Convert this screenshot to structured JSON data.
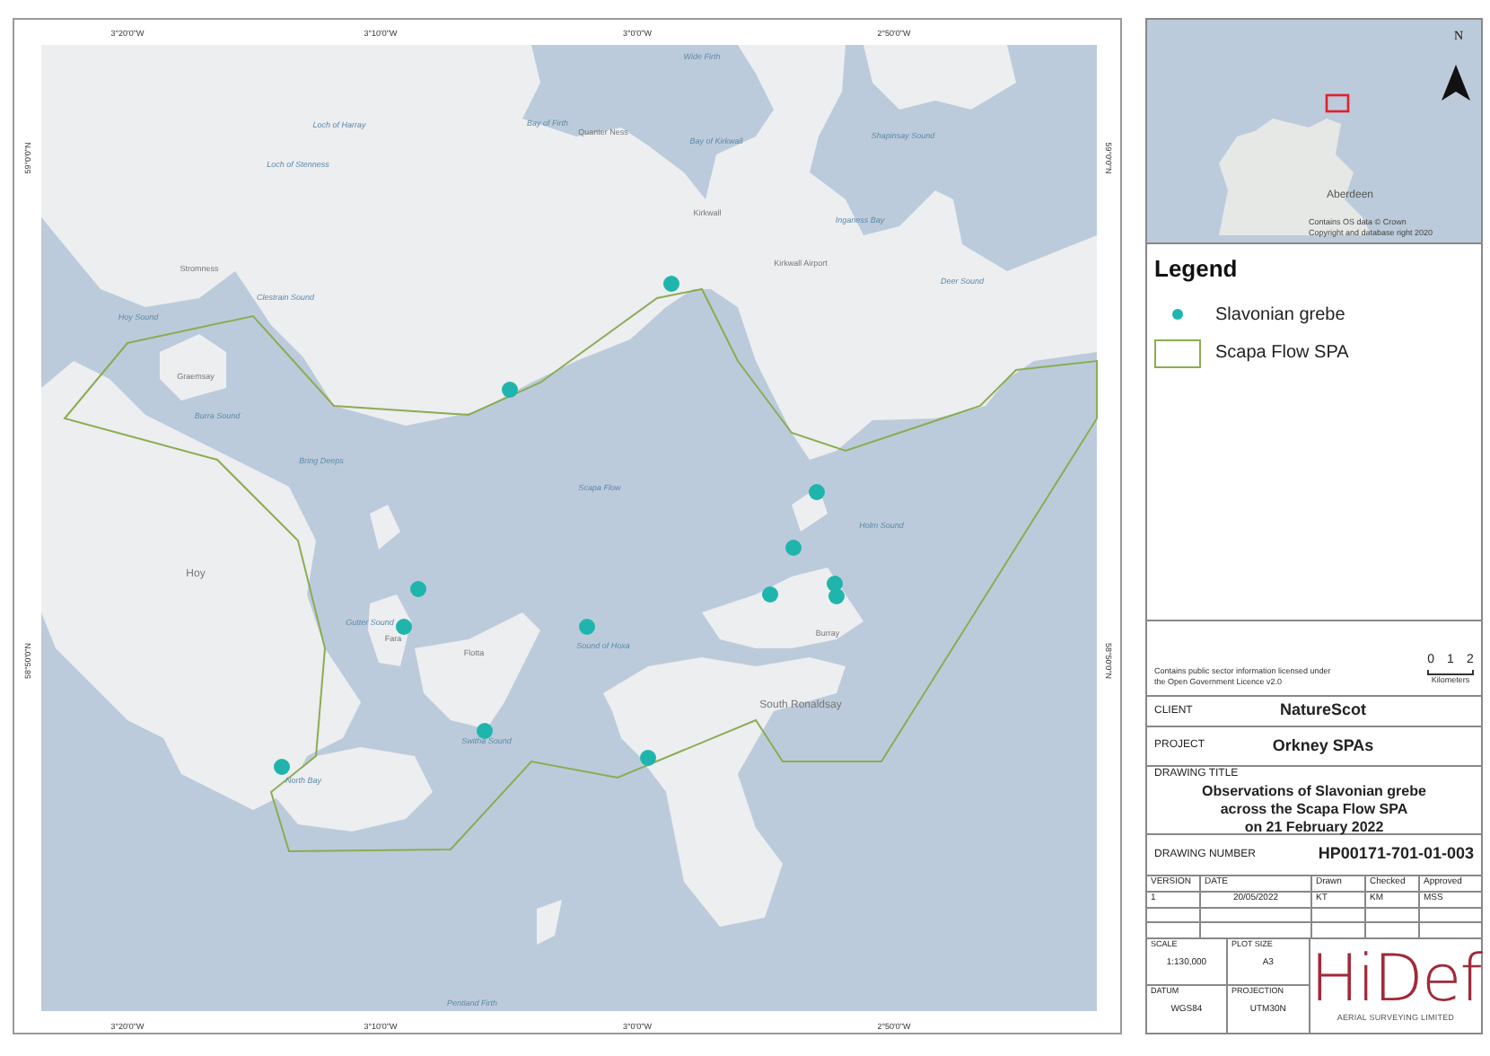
{
  "map": {
    "axis_top": [
      "3°20'0\"W",
      "3°10'0\"W",
      "3°0'0\"W",
      "2°50'0\"W"
    ],
    "axis_bottom": [
      "3°20'0\"W",
      "3°10'0\"W",
      "3°0'0\"W",
      "2°50'0\"W"
    ],
    "axis_left": [
      "59°0'0\"N",
      "58°50'0\"N"
    ],
    "axis_right": [
      "59°0'0\"N",
      "58°50'0\"N"
    ],
    "places": [
      "Wide Firth",
      "Bay of Firth",
      "Quanter Ness",
      "Bay of Kirkwall",
      "Shapinsay Sound",
      "Loch of Harray",
      "Loch of Stenness",
      "Kirkwall",
      "Inganess Bay",
      "Kirkwall Airport",
      "Deer Sound",
      "Stromness",
      "Clestrain Sound",
      "Hoy Sound",
      "Graemsay",
      "Burra Sound",
      "Bring Deeps",
      "Scapa Flow",
      "Holm Sound",
      "Hoy",
      "Gutter Sound",
      "Fara",
      "Flotta",
      "Sound of Hoxa",
      "Burray",
      "Switha Sound",
      "North Bay",
      "South Ronaldsay",
      "Pentland Firth"
    ]
  },
  "inset": {
    "north": "N",
    "city": "Aberdeen",
    "credit": [
      "Contains OS data © Crown",
      "Copyright and database right 2020"
    ]
  },
  "legend": {
    "title": "Legend",
    "items": [
      {
        "label": "Slavonian grebe",
        "kind": "point",
        "color": "#1fb5ad"
      },
      {
        "label": "Scapa Flow SPA",
        "kind": "area",
        "color": "#8cac52"
      }
    ]
  },
  "credit": [
    "Contains public sector information licensed under",
    "the Open Government Licence v2.0"
  ],
  "scale_bar": {
    "ticks": [
      "0",
      "1",
      "2"
    ],
    "units": "Kilometers"
  },
  "client": {
    "label": "CLIENT",
    "value": "NatureScot"
  },
  "project": {
    "label": "PROJECT",
    "value": "Orkney SPAs"
  },
  "drawing_title": {
    "label": "DRAWING TITLE",
    "lines": [
      "Observations of Slavonian grebe",
      "across the Scapa Flow SPA",
      "on 21 February 2022"
    ]
  },
  "drawing_number": {
    "label": "DRAWING NUMBER",
    "value": "HP00171-701-01-003"
  },
  "revisions": {
    "columns": [
      "VERSION",
      "DATE",
      "Drawn",
      "Checked",
      "Approved"
    ],
    "rows": [
      [
        "1",
        "20/05/2022",
        "KT",
        "KM",
        "MSS"
      ]
    ]
  },
  "details": [
    {
      "label": "SCALE",
      "value": "1:130,000"
    },
    {
      "label": "PLOT SIZE",
      "value": "A3"
    },
    {
      "label": "DATUM",
      "value": "WGS84"
    },
    {
      "label": "PROJECTION",
      "value": "UTM30N"
    }
  ],
  "logo": {
    "text": "HiDef",
    "subtitle": "AERIAL SURVEYING LIMITED"
  }
}
